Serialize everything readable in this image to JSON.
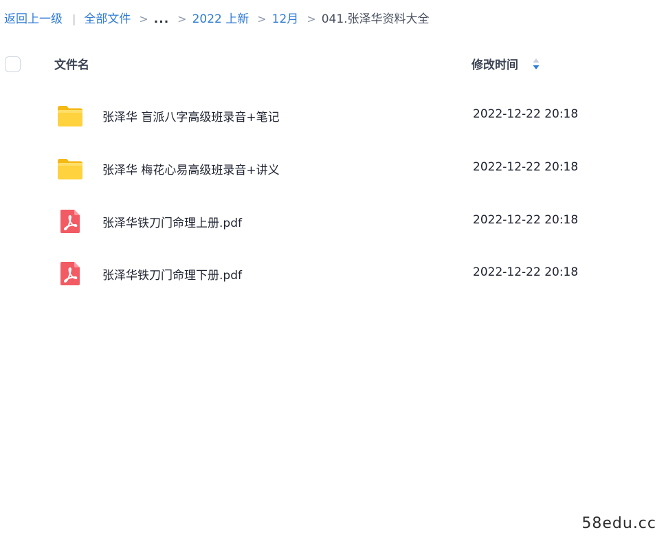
{
  "breadcrumb": {
    "back": "返回上一级",
    "separator_bar": "|",
    "root": "全部文件",
    "separator": ">",
    "ellipsis": "...",
    "level1": "2022 上新",
    "level2": "12月",
    "current": "041.张泽华资料大全"
  },
  "table": {
    "column_name": "文件名",
    "column_time": "修改时间",
    "sort_icon": "sort-updown-icon",
    "accent_color": "#2f7bd6",
    "rows": [
      {
        "name": "张泽华 盲派八字高级班录音+笔记",
        "time": "2022-12-22 20:18",
        "type": "folder",
        "icon": "folder-icon"
      },
      {
        "name": "张泽华 梅花心易高级班录音+讲义",
        "time": "2022-12-22 20:18",
        "type": "folder",
        "icon": "folder-icon"
      },
      {
        "name": "张泽华铁刀门命理上册.pdf",
        "time": "2022-12-22 20:18",
        "type": "pdf",
        "icon": "pdf-icon"
      },
      {
        "name": "张泽华铁刀门命理下册.pdf",
        "time": "2022-12-22 20:18",
        "type": "pdf",
        "icon": "pdf-icon"
      }
    ]
  },
  "watermark": "58edu.cc"
}
